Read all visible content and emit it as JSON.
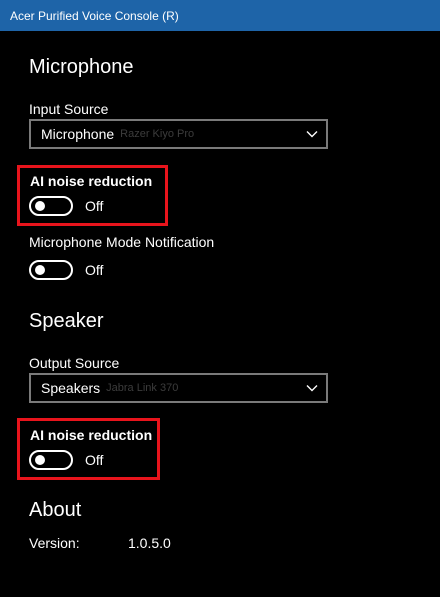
{
  "window": {
    "title": "Acer Purified Voice Console (R)"
  },
  "microphone": {
    "section_title": "Microphone",
    "input_source_label": "Input Source",
    "input_source_value": "Microphone",
    "input_source_device": "Razer Kiyo Pro",
    "ai_noise_label": "AI noise reduction",
    "ai_noise_state": "Off",
    "mode_notification_label": "Microphone Mode Notification",
    "mode_notification_state": "Off"
  },
  "speaker": {
    "section_title": "Speaker",
    "output_source_label": "Output Source",
    "output_source_value": "Speakers",
    "output_source_device": "Jabra Link 370",
    "ai_noise_label": "AI noise reduction",
    "ai_noise_state": "Off"
  },
  "about": {
    "section_title": "About",
    "version_label": "Version:",
    "version_value": "1.0.5.0"
  },
  "colors": {
    "titlebar": "#1e64a8",
    "background": "#000000",
    "highlight": "#e8141c",
    "dropdown_border": "#7a7a7a"
  },
  "icons": {
    "dropdown": "chevron-down-icon"
  }
}
